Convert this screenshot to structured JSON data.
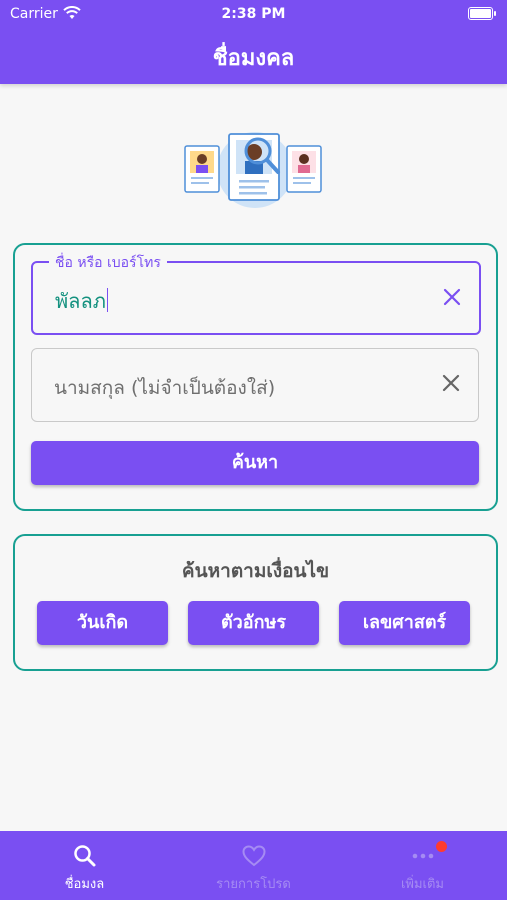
{
  "status_bar": {
    "carrier": "Carrier",
    "time": "2:38 PM"
  },
  "header": {
    "title": "ชื่อมงคล"
  },
  "form": {
    "name_field": {
      "label": "ชื่อ หรือ เบอร์โทร",
      "value": "พัลลภ"
    },
    "surname_field": {
      "placeholder": "นามสกุล (ไม่จำเป็นต้องใส่)"
    },
    "search_button": "ค้นหา"
  },
  "conditions": {
    "title": "ค้นหาตามเงื่อนไข",
    "buttons": [
      "วันเกิด",
      "ตัวอักษร",
      "เลขศาสตร์"
    ]
  },
  "tabs": [
    {
      "label": "ชื่อมงล",
      "icon": "search-icon",
      "active": true
    },
    {
      "label": "รายการโปรด",
      "icon": "heart-icon",
      "active": false
    },
    {
      "label": "เพิ่มเติม",
      "icon": "more-icon",
      "active": false,
      "badge": true
    }
  ],
  "colors": {
    "accent": "#7a4ff2",
    "frame": "#18a092",
    "badge": "#ff3b30"
  }
}
